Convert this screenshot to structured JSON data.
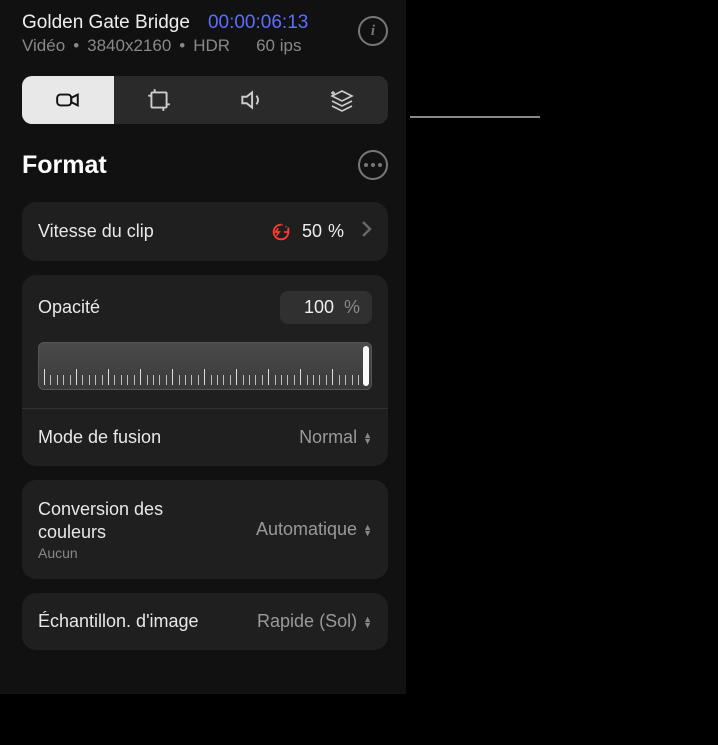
{
  "header": {
    "title": "Golden Gate Bridge",
    "timecode": "00:00:06:13",
    "meta_type": "Vidéo",
    "meta_res": "3840x2160",
    "meta_hdr": "HDR",
    "meta_fps": "60 ips"
  },
  "section": {
    "title": "Format"
  },
  "speed": {
    "label": "Vitesse du clip",
    "value": "50",
    "unit": "%"
  },
  "opacity": {
    "label": "Opacité",
    "value": "100",
    "unit": "%"
  },
  "blend": {
    "label": "Mode de fusion",
    "value": "Normal"
  },
  "color": {
    "label": "Conversion des couleurs",
    "sub": "Aucun",
    "value": "Automatique"
  },
  "sample": {
    "label": "Échantillon. d'image",
    "value": "Rapide (Sol)"
  }
}
